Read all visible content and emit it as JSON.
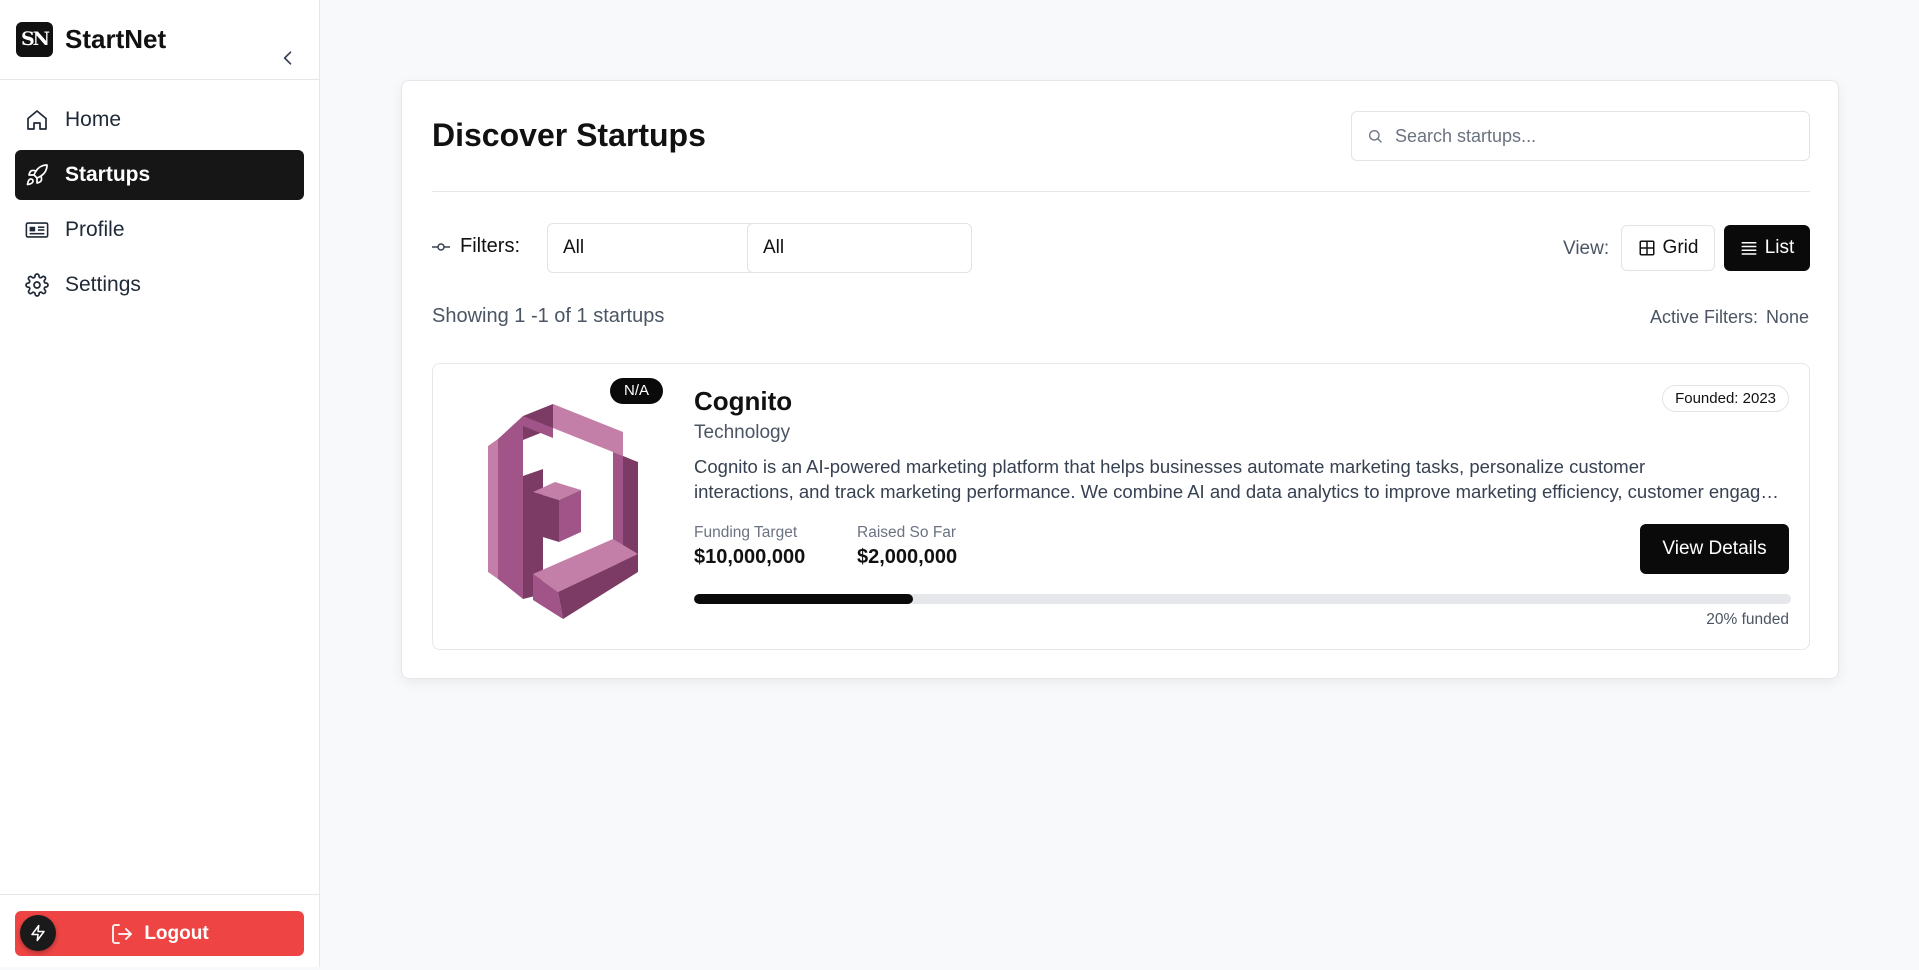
{
  "brand": {
    "logo_text": "SN",
    "name": "StartNet"
  },
  "sidebar": {
    "items": [
      {
        "label": "Home",
        "icon": "home-icon",
        "active": false
      },
      {
        "label": "Startups",
        "icon": "rocket-icon",
        "active": true
      },
      {
        "label": "Profile",
        "icon": "id-card-icon",
        "active": false
      },
      {
        "label": "Settings",
        "icon": "gear-icon",
        "active": false
      }
    ],
    "logout_label": "Logout"
  },
  "main": {
    "title": "Discover Startups",
    "search_placeholder": "Search startups...",
    "filters_label": "Filters:",
    "filter_1_value": "All",
    "filter_2_value": "All",
    "view_label": "View:",
    "view_grid_label": "Grid",
    "view_list_label": "List",
    "showing_text": "Showing 1 -1 of 1 startups",
    "active_filters_label": "Active Filters:",
    "active_filters_value": "None"
  },
  "startups": [
    {
      "badge": "N/A",
      "name": "Cognito",
      "category": "Technology",
      "founded": "Founded: 2023",
      "description_line_1": "Cognito is an AI-powered marketing platform that helps businesses automate marketing tasks, personalize customer",
      "description_line_2": "interactions, and track marketing performance. We combine AI and data analytics to improve marketing efficiency, customer engagement, and revenue growth.",
      "funding_target_label": "Funding Target",
      "funding_target": "$10,000,000",
      "raised_label": "Raised So Far",
      "raised": "$2,000,000",
      "details_label": "View Details",
      "funded_fraction": 0.2,
      "funded_text": "20% funded"
    }
  ],
  "colors": {
    "accent": "#0a0a0a",
    "logout": "#ef4444",
    "logo_light": "#c47fa8",
    "logo_mid": "#a05487",
    "logo_dark": "#7b3b65"
  }
}
